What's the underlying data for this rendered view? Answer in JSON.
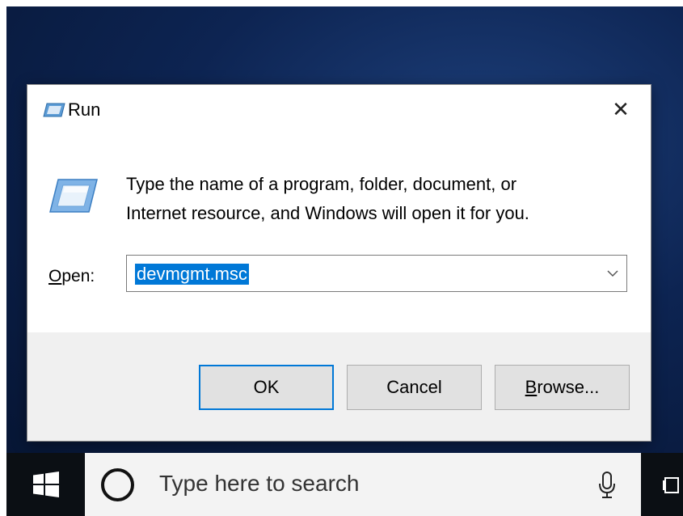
{
  "dialog": {
    "title": "Run",
    "close_glyph": "✕",
    "description_line1": "Type the name of a program, folder, document, or",
    "description_line2": "Internet resource, and Windows will open it for you.",
    "open_label_mnemonic": "O",
    "open_label_rest": "pen:",
    "open_value": "devmgmt.msc",
    "buttons": {
      "ok": "OK",
      "cancel": "Cancel",
      "browse_mnemonic": "B",
      "browse_rest": "rowse..."
    }
  },
  "taskbar": {
    "search_placeholder": "Type here to search"
  },
  "icons": {
    "title": "run-icon",
    "big": "run-icon",
    "close": "close-icon",
    "dropdown": "chevron-down-icon",
    "start": "windows-logo-icon",
    "cortana": "cortana-icon",
    "mic": "microphone-icon",
    "taskview": "task-view-icon"
  },
  "colors": {
    "selection": "#0078d7",
    "desktop": "#0d2452",
    "taskbar": "#0b0f14"
  }
}
